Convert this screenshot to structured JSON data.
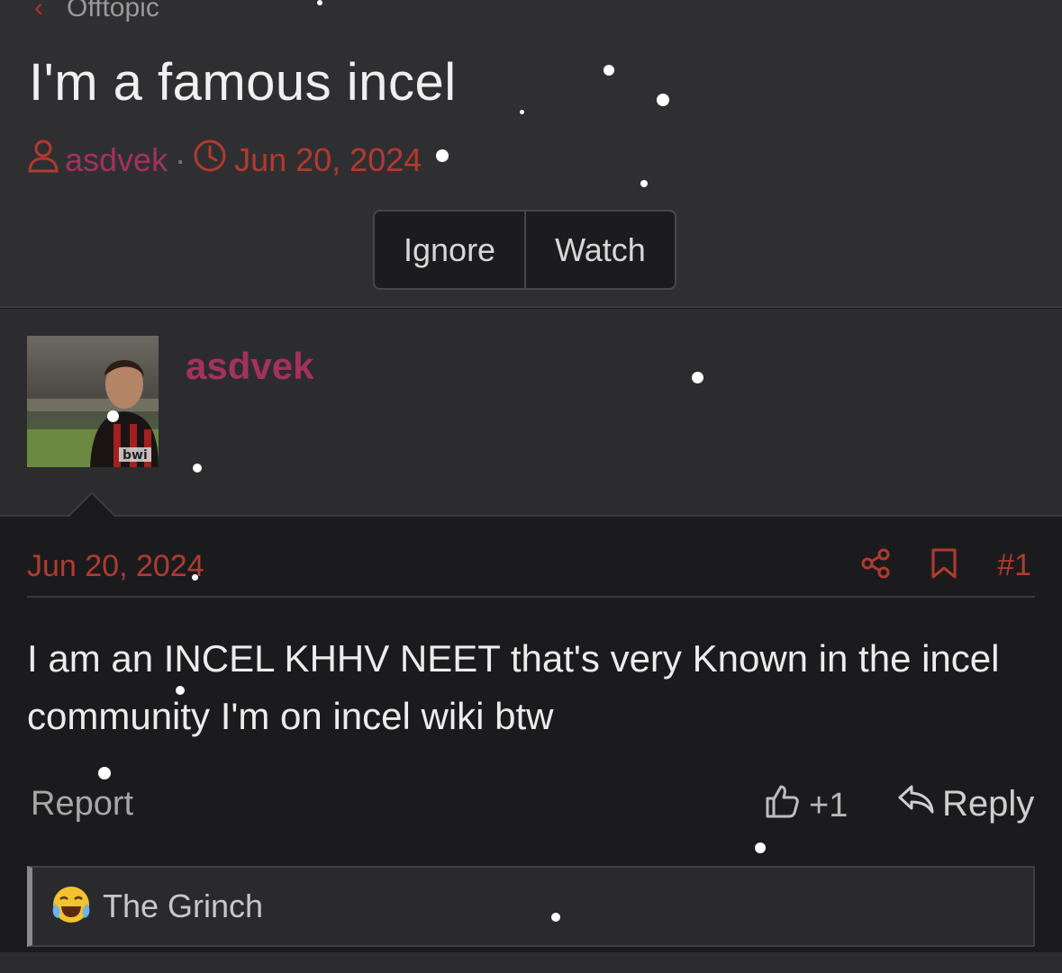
{
  "breadcrumb": {
    "label": "Offtopic"
  },
  "thread": {
    "title": "I'm a famous incel",
    "author": "asdvek",
    "separator": "·",
    "date": "Jun 20, 2024",
    "buttons": {
      "ignore": "Ignore",
      "watch": "Watch"
    }
  },
  "post": {
    "username": "asdvek",
    "avatar_text": "bwi",
    "date": "Jun 20, 2024",
    "number": "#1",
    "body": "I am an INCEL KHHV NEET that's very Known in the incel community I'm on incel wiki btw",
    "report": "Report",
    "reaction_count": "+1",
    "reply": "Reply",
    "reacted_by": "The Grinch"
  },
  "colors": {
    "accent_red": "#b23a30",
    "username_pink": "#a3325d",
    "background": "#1b1b1d",
    "panel": "#2f2f31"
  },
  "icons": [
    "chevron-left-icon",
    "user-icon",
    "clock-icon",
    "share-icon",
    "bookmark-icon",
    "thumbs-up-icon",
    "reply-icon",
    "laughing-crying-emoji-icon"
  ]
}
